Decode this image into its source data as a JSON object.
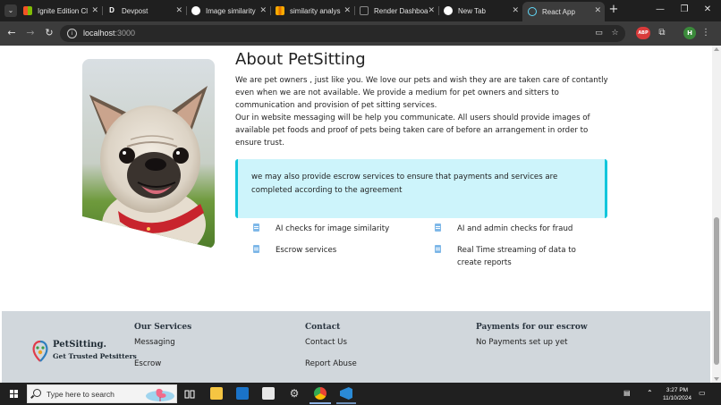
{
  "browser": {
    "tabs": [
      {
        "title": "Ignite Edition Cl",
        "icon": "windows-grid-icon"
      },
      {
        "title": "Devpost",
        "icon": "devpost-icon"
      },
      {
        "title": "Image similarity",
        "icon": "openai-icon"
      },
      {
        "title": "similarity analys",
        "icon": "chart-icon"
      },
      {
        "title": "Render Dashboa",
        "icon": "render-icon"
      },
      {
        "title": "New Tab",
        "icon": "chrome-icon"
      },
      {
        "title": "React App",
        "icon": "react-icon",
        "active": true
      }
    ],
    "url_host": "localhost",
    "url_port": ":3000",
    "ext_badge": "ABP",
    "profile_initial": "H"
  },
  "about": {
    "title": "About PetSitting",
    "p1": "We are pet owners , just like you. We love our pets and wish they are are taken care of contantly even when we are not available. We provide a medium for pet owners and sitters to communication and provision of pet sitting services.",
    "p2": "Our in website messaging will be help you communicate. All users should provide images of available pet foods and proof of pets being taken care of before an arrangement in order to ensure trust.",
    "callout": "we may also provide escrow services to ensure that payments and services are completed according to the agreement",
    "features": [
      "AI checks for image similarity",
      "AI and admin checks for fraud",
      "Escrow services",
      "Real Time streaming of data to create reports"
    ]
  },
  "footer": {
    "logo_title": "PetSitting.",
    "logo_sub": "Get Trusted Petsitters",
    "services_title": "Our Services",
    "services": [
      "Messaging",
      "Escrow"
    ],
    "contact_title": "Contact",
    "contact": [
      "Contact Us",
      "Report Abuse"
    ],
    "payments_title": "Payments for our escrow",
    "payments_text": "No Payments set up yet"
  },
  "taskbar": {
    "search_placeholder": "Type here to search",
    "time": "3:27 PM",
    "date": "11/10/2024"
  },
  "colors": {
    "callout_bg": "#cdf4fb",
    "callout_border": "#12c6dc",
    "footer_bg": "#d1d7dc"
  }
}
